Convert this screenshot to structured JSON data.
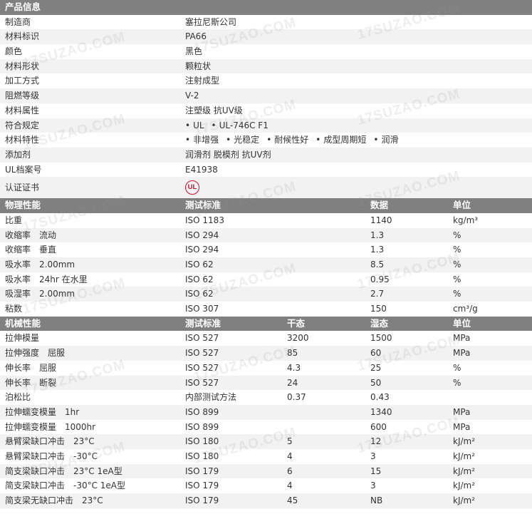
{
  "watermark": "17SUZAO.COM",
  "colors": {
    "header_bg": "#808080",
    "row_alt": "#f2f2f2",
    "ul_red": "#c8102e"
  },
  "product_info": {
    "title": "产品信息",
    "rows": [
      {
        "label": "制造商",
        "value": "塞拉尼斯公司"
      },
      {
        "label": "材料标识",
        "value": "PA66"
      },
      {
        "label": "颜色",
        "value": "黑色"
      },
      {
        "label": "材料形状",
        "value": "颗粒状"
      },
      {
        "label": "加工方式",
        "value": "注射成型"
      },
      {
        "label": "阻燃等级",
        "value": "V-2"
      },
      {
        "label": "材料属性",
        "value": "注塑级 抗UV级"
      },
      {
        "label": "符合规定",
        "bullets": [
          "UL",
          "UL-746C F1"
        ]
      },
      {
        "label": "材料特性",
        "bullets": [
          "非增强",
          "光稳定",
          "耐候性好",
          "成型周期短",
          "润滑"
        ]
      },
      {
        "label": "添加剂",
        "value": "润滑剂 脱模剂 抗UV剂"
      },
      {
        "label": "UL档案号",
        "value": "E41938"
      },
      {
        "label": "认证证书",
        "logo_text": "UL",
        "logo_icon": "ul-certification-icon"
      }
    ]
  },
  "physical": {
    "headers": [
      "物理性能",
      "测试标准",
      "数据",
      "单位"
    ],
    "rows": [
      {
        "prop": "比重",
        "std": "ISO 1183",
        "val": "1140",
        "unit": "kg/m³"
      },
      {
        "prop": "收缩率　流动",
        "std": "ISO 294",
        "val": "1.3",
        "unit": "%"
      },
      {
        "prop": "收缩率　垂直",
        "std": "ISO 294",
        "val": "1.3",
        "unit": "%"
      },
      {
        "prop": "吸水率　2.00mm",
        "std": "ISO 62",
        "val": "8.5",
        "unit": "%"
      },
      {
        "prop": "吸水率　24hr 在水里",
        "std": "ISO 62",
        "val": "0.95",
        "unit": "%"
      },
      {
        "prop": "吸湿率　2.00mm",
        "std": "ISO 62",
        "val": "2.7",
        "unit": "%"
      },
      {
        "prop": "粘数",
        "std": "ISO 307",
        "val": "150",
        "unit": "cm³/g"
      }
    ]
  },
  "mechanical": {
    "headers": [
      "机械性能",
      "测试标准",
      "干态",
      "湿态",
      "单位"
    ],
    "rows": [
      {
        "prop": "拉伸模量",
        "std": "ISO 527",
        "dry": "3200",
        "wet": "1500",
        "unit": "MPa"
      },
      {
        "prop": "拉伸强度　屈服",
        "std": "ISO 527",
        "dry": "85",
        "wet": "60",
        "unit": "MPa"
      },
      {
        "prop": "伸长率　屈服",
        "std": "ISO 527",
        "dry": "4.3",
        "wet": "25",
        "unit": "%"
      },
      {
        "prop": "伸长率　断裂",
        "std": "ISO 527",
        "dry": "24",
        "wet": "50",
        "unit": "%"
      },
      {
        "prop": "泊松比",
        "std": "内部测试方法",
        "dry": "0.37",
        "wet": "0.43",
        "unit": ""
      },
      {
        "prop": "拉伸蠕变模量　1hr",
        "std": "ISO 899",
        "dry": "",
        "wet": "1340",
        "unit": "MPa"
      },
      {
        "prop": "拉伸蠕变模量　1000hr",
        "std": "ISO 899",
        "dry": "",
        "wet": "600",
        "unit": "MPa"
      },
      {
        "prop": "悬臂梁缺口冲击　23°C",
        "std": "ISO 180",
        "dry": "5",
        "wet": "12",
        "unit": "kJ/m²"
      },
      {
        "prop": "悬臂梁缺口冲击　-30°C",
        "std": "ISO 180",
        "dry": "4",
        "wet": "3",
        "unit": "kJ/m²"
      },
      {
        "prop": "简支梁缺口冲击　23°C 1eA型",
        "std": "ISO 179",
        "dry": "6",
        "wet": "15",
        "unit": "kJ/m²"
      },
      {
        "prop": "简支梁缺口冲击　-30°C 1eA型",
        "std": "ISO 179",
        "dry": "4",
        "wet": "3",
        "unit": "kJ/m²"
      },
      {
        "prop": "简支梁无缺口冲击　23°C",
        "std": "ISO 179",
        "dry": "45",
        "wet": "NB",
        "unit": "kJ/m²"
      }
    ]
  }
}
